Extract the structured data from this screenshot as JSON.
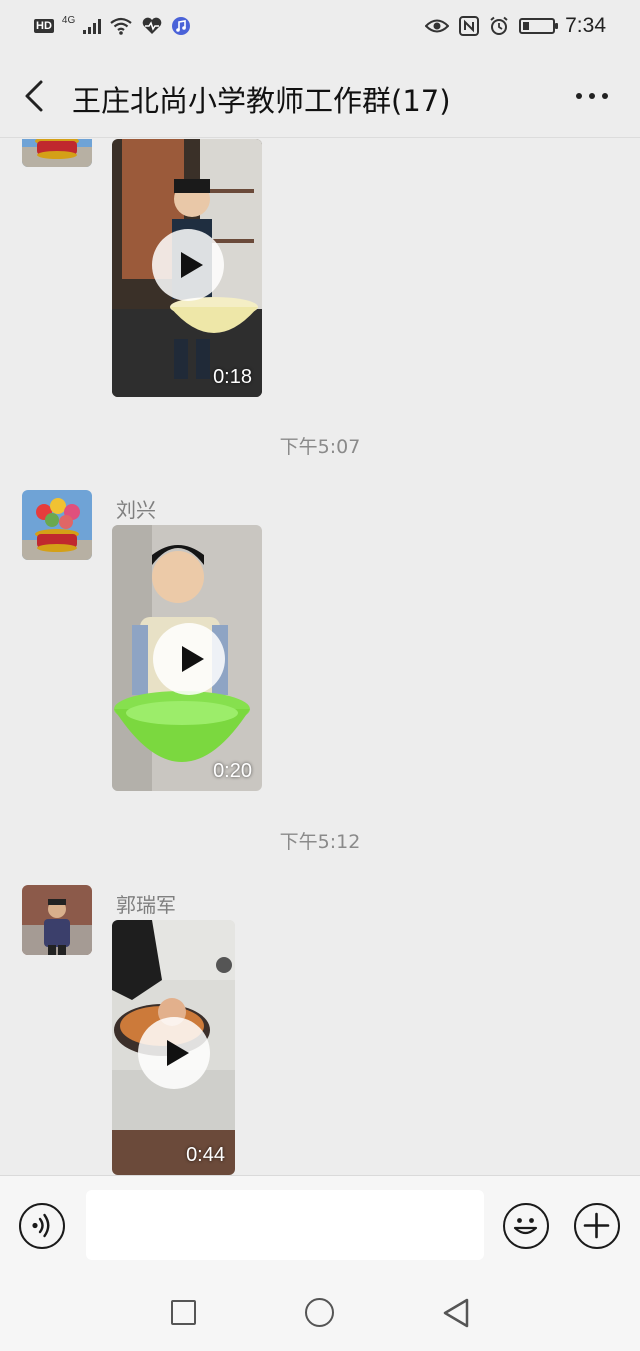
{
  "status_bar": {
    "time": "7:34",
    "network": "4G",
    "hd": "HD",
    "battery_level": 0.2,
    "icons": [
      "hd-icon",
      "signal-icon",
      "wifi-icon",
      "health-icon",
      "music-icon",
      "eye-icon",
      "nfc-icon",
      "alarm-icon",
      "battery-icon"
    ]
  },
  "header": {
    "title": "王庄北尚小学教师工作群(17)",
    "back_icon": "chevron-left-icon",
    "more_icon": "more-dots-icon"
  },
  "messages": [
    {
      "type": "video",
      "sender": "",
      "duration": "0:18",
      "thumb": "boy-holding-yellow-basin"
    },
    {
      "type": "timestamp",
      "text": "下午5:07"
    },
    {
      "type": "video",
      "sender": "刘兴",
      "duration": "0:20",
      "thumb": "boy-holding-green-basin"
    },
    {
      "type": "timestamp",
      "text": "下午5:12"
    },
    {
      "type": "video",
      "sender": "郭瑞军",
      "duration": "0:44",
      "thumb": "hands-washing-in-sink"
    }
  ],
  "input_bar": {
    "value": "",
    "icons": [
      "voice-icon",
      "emoji-icon",
      "plus-icon"
    ]
  },
  "nav_bar": {
    "icons": [
      "recent-apps-icon",
      "home-icon",
      "back-icon"
    ]
  },
  "colors": {
    "background": "#ededed",
    "bar": "#f6f6f6",
    "timestamp_text": "#8a8a8a",
    "sender_text": "#7f7f7f"
  }
}
